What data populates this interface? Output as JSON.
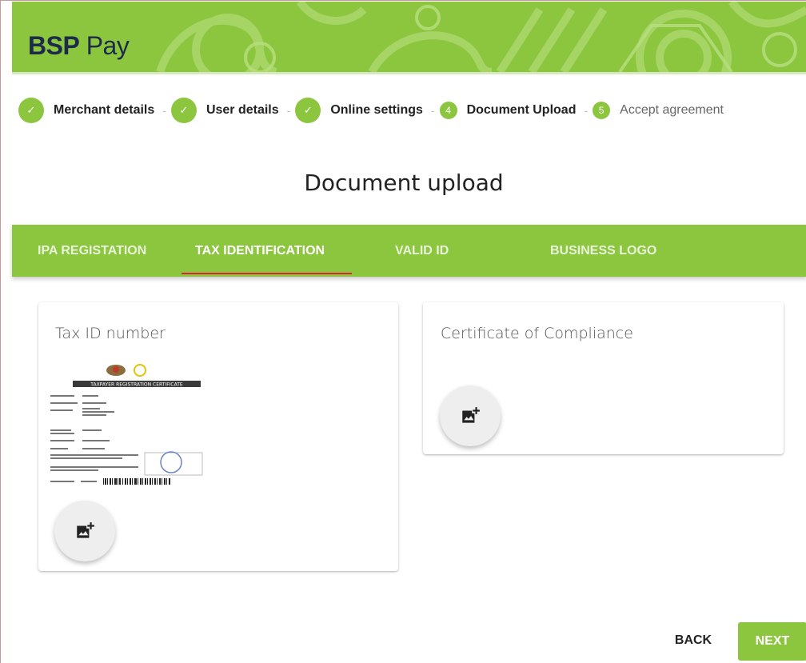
{
  "brand": {
    "name_bold": "BSP",
    "name_light": "Pay"
  },
  "stepper": {
    "steps": [
      {
        "label": "Merchant details",
        "marker": "✓",
        "state": "done"
      },
      {
        "label": "User details",
        "marker": "✓",
        "state": "done"
      },
      {
        "label": "Online settings",
        "marker": "✓",
        "state": "done"
      },
      {
        "label": "Document Upload",
        "marker": "4",
        "state": "active"
      },
      {
        "label": "Accept agreement",
        "marker": "5",
        "state": "pending"
      }
    ],
    "separator": "-"
  },
  "page_title": "Document upload",
  "tabs": [
    {
      "label": "IPA REGISTATION",
      "active": false
    },
    {
      "label": "TAX IDENTIFICATION",
      "active": true
    },
    {
      "label": "VALID ID",
      "active": false
    },
    {
      "label": "BUSINESS LOGO",
      "active": false
    }
  ],
  "cards": {
    "tax_id": {
      "title": "Tax ID number",
      "has_document": true
    },
    "compliance": {
      "title": "Certificate of Compliance",
      "has_document": false
    }
  },
  "document_preview": {
    "heading": "TAXPAYER REGISTRATION CERTIFICATE"
  },
  "buttons": {
    "back": "BACK",
    "next": "NEXT"
  },
  "colors": {
    "brand_green": "#8cc63f",
    "tab_indicator": "#e0203a",
    "brand_text": "#1d2a4a"
  },
  "icons": {
    "step_done": "check-icon",
    "upload": "add-photo-icon"
  }
}
